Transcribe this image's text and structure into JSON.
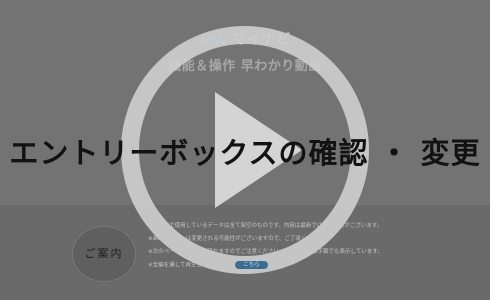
{
  "brand": {
    "name": "マイナビ",
    "logo_icon": "mynavi-logo-icon"
  },
  "video": {
    "subtitle": "機能＆操作 早わかり動画",
    "title": "エントリーボックスの確認 ・ 変更",
    "play_icon": "play-icon"
  },
  "guide": {
    "label": "ご案内"
  },
  "notes": [
    "※動画内で使用しているデータは全て架空のものです。内容は最新ではない場合がございます。",
    "※画面デザインは変更される可能性がございますので、ご了承ください。",
    "※次のページから音声が流れますのでご注意ください。音声の内容は字幕でも表示しています。"
  ],
  "notes_last": {
    "text": "※全編を通して再生したい場合は",
    "link": "こちら"
  },
  "colors": {
    "link": "#3b6d93"
  }
}
